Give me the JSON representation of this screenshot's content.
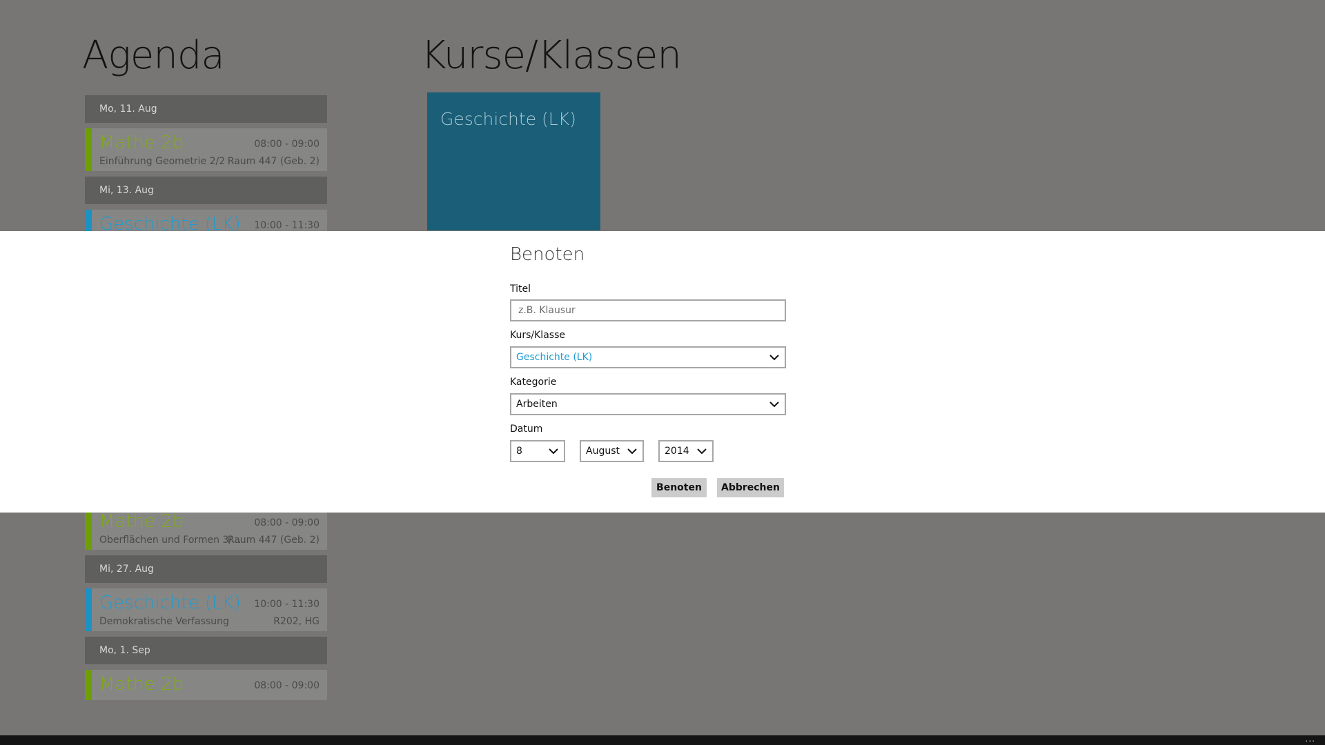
{
  "page_titles": {
    "agenda": "Agenda",
    "courses": "Kurse/Klassen"
  },
  "agenda_upper": {
    "days": [
      {
        "header": "Mo,   11. Aug",
        "entries": [
          {
            "course": "Mathe 2b",
            "time": "08:00 - 09:00",
            "topic": "Einführung Geometrie 2/2",
            "room": "Raum 447 (Geb. 2)"
          }
        ]
      },
      {
        "header": "Mi,   13. Aug",
        "entries": [
          {
            "course": "Geschichte (LK)",
            "time": "10:00 - 11:30",
            "topic": "",
            "room": ""
          }
        ]
      }
    ]
  },
  "agenda_lower": {
    "entries_top": [
      {
        "course": "Mathe 2b",
        "time": "08:00 - 09:00",
        "topic": "Oberflächen und Formen 3/...",
        "room": "Raum 447 (Geb. 2)"
      }
    ],
    "days": [
      {
        "header": "Mi,   27. Aug",
        "entries": [
          {
            "course": "Geschichte (LK)",
            "time": "10:00 - 11:30",
            "topic": "Demokratische Verfassung",
            "room": "R202, HG"
          }
        ]
      },
      {
        "header": "Mo,   1. Sep",
        "entries": [
          {
            "course": "Mathe 2b",
            "time": "08:00 - 09:00",
            "topic": "",
            "room": ""
          }
        ]
      }
    ]
  },
  "course_tiles": [
    {
      "label": "Geschichte (LK)",
      "color": "#1a5e78"
    }
  ],
  "dialog": {
    "title": "Benoten",
    "fields": {
      "titel": {
        "label": "Titel",
        "value": "",
        "placeholder": "z.B. Klausur"
      },
      "kurs": {
        "label": "Kurs/Klasse",
        "value": "Geschichte (LK)"
      },
      "kategorie": {
        "label": "Kategorie",
        "value": "Arbeiten"
      },
      "datum": {
        "label": "Datum",
        "day": "8",
        "month": "August",
        "year": "2014"
      }
    },
    "buttons": {
      "confirm": "Benoten",
      "cancel": "Abbrechen"
    }
  },
  "bottom_bar": {
    "more": "..."
  },
  "colors": {
    "accent_blue": "#1e9cd0",
    "accent_green": "#80ad12",
    "overlay": "#777674"
  },
  "icons": {
    "dropdown": "chevron-down-icon",
    "more": "more-dots-icon"
  }
}
